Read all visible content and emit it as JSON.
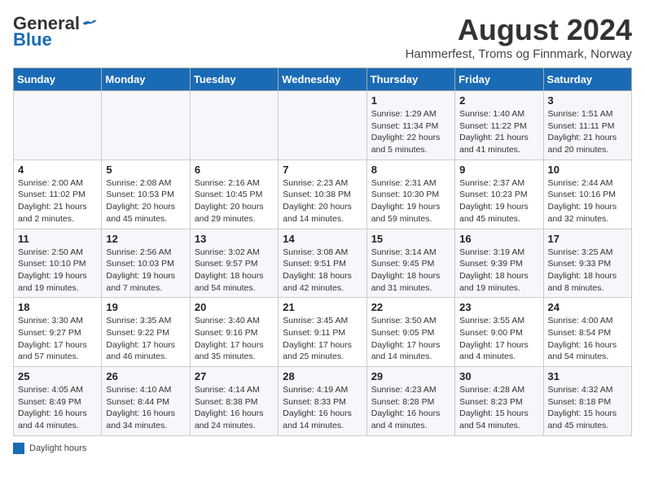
{
  "logo": {
    "general": "General",
    "blue": "Blue"
  },
  "title": "August 2024",
  "subtitle": "Hammerfest, Troms og Finnmark, Norway",
  "days_of_week": [
    "Sunday",
    "Monday",
    "Tuesday",
    "Wednesday",
    "Thursday",
    "Friday",
    "Saturday"
  ],
  "footer_label": "Daylight hours",
  "weeks": [
    [
      {
        "day": "",
        "info": ""
      },
      {
        "day": "",
        "info": ""
      },
      {
        "day": "",
        "info": ""
      },
      {
        "day": "",
        "info": ""
      },
      {
        "day": "1",
        "info": "Sunrise: 1:29 AM\nSunset: 11:34 PM\nDaylight: 22 hours and 5 minutes."
      },
      {
        "day": "2",
        "info": "Sunrise: 1:40 AM\nSunset: 11:22 PM\nDaylight: 21 hours and 41 minutes."
      },
      {
        "day": "3",
        "info": "Sunrise: 1:51 AM\nSunset: 11:11 PM\nDaylight: 21 hours and 20 minutes."
      }
    ],
    [
      {
        "day": "4",
        "info": "Sunrise: 2:00 AM\nSunset: 11:02 PM\nDaylight: 21 hours and 2 minutes."
      },
      {
        "day": "5",
        "info": "Sunrise: 2:08 AM\nSunset: 10:53 PM\nDaylight: 20 hours and 45 minutes."
      },
      {
        "day": "6",
        "info": "Sunrise: 2:16 AM\nSunset: 10:45 PM\nDaylight: 20 hours and 29 minutes."
      },
      {
        "day": "7",
        "info": "Sunrise: 2:23 AM\nSunset: 10:38 PM\nDaylight: 20 hours and 14 minutes."
      },
      {
        "day": "8",
        "info": "Sunrise: 2:31 AM\nSunset: 10:30 PM\nDaylight: 19 hours and 59 minutes."
      },
      {
        "day": "9",
        "info": "Sunrise: 2:37 AM\nSunset: 10:23 PM\nDaylight: 19 hours and 45 minutes."
      },
      {
        "day": "10",
        "info": "Sunrise: 2:44 AM\nSunset: 10:16 PM\nDaylight: 19 hours and 32 minutes."
      }
    ],
    [
      {
        "day": "11",
        "info": "Sunrise: 2:50 AM\nSunset: 10:10 PM\nDaylight: 19 hours and 19 minutes."
      },
      {
        "day": "12",
        "info": "Sunrise: 2:56 AM\nSunset: 10:03 PM\nDaylight: 19 hours and 7 minutes."
      },
      {
        "day": "13",
        "info": "Sunrise: 3:02 AM\nSunset: 9:57 PM\nDaylight: 18 hours and 54 minutes."
      },
      {
        "day": "14",
        "info": "Sunrise: 3:08 AM\nSunset: 9:51 PM\nDaylight: 18 hours and 42 minutes."
      },
      {
        "day": "15",
        "info": "Sunrise: 3:14 AM\nSunset: 9:45 PM\nDaylight: 18 hours and 31 minutes."
      },
      {
        "day": "16",
        "info": "Sunrise: 3:19 AM\nSunset: 9:39 PM\nDaylight: 18 hours and 19 minutes."
      },
      {
        "day": "17",
        "info": "Sunrise: 3:25 AM\nSunset: 9:33 PM\nDaylight: 18 hours and 8 minutes."
      }
    ],
    [
      {
        "day": "18",
        "info": "Sunrise: 3:30 AM\nSunset: 9:27 PM\nDaylight: 17 hours and 57 minutes."
      },
      {
        "day": "19",
        "info": "Sunrise: 3:35 AM\nSunset: 9:22 PM\nDaylight: 17 hours and 46 minutes."
      },
      {
        "day": "20",
        "info": "Sunrise: 3:40 AM\nSunset: 9:16 PM\nDaylight: 17 hours and 35 minutes."
      },
      {
        "day": "21",
        "info": "Sunrise: 3:45 AM\nSunset: 9:11 PM\nDaylight: 17 hours and 25 minutes."
      },
      {
        "day": "22",
        "info": "Sunrise: 3:50 AM\nSunset: 9:05 PM\nDaylight: 17 hours and 14 minutes."
      },
      {
        "day": "23",
        "info": "Sunrise: 3:55 AM\nSunset: 9:00 PM\nDaylight: 17 hours and 4 minutes."
      },
      {
        "day": "24",
        "info": "Sunrise: 4:00 AM\nSunset: 8:54 PM\nDaylight: 16 hours and 54 minutes."
      }
    ],
    [
      {
        "day": "25",
        "info": "Sunrise: 4:05 AM\nSunset: 8:49 PM\nDaylight: 16 hours and 44 minutes."
      },
      {
        "day": "26",
        "info": "Sunrise: 4:10 AM\nSunset: 8:44 PM\nDaylight: 16 hours and 34 minutes."
      },
      {
        "day": "27",
        "info": "Sunrise: 4:14 AM\nSunset: 8:38 PM\nDaylight: 16 hours and 24 minutes."
      },
      {
        "day": "28",
        "info": "Sunrise: 4:19 AM\nSunset: 8:33 PM\nDaylight: 16 hours and 14 minutes."
      },
      {
        "day": "29",
        "info": "Sunrise: 4:23 AM\nSunset: 8:28 PM\nDaylight: 16 hours and 4 minutes."
      },
      {
        "day": "30",
        "info": "Sunrise: 4:28 AM\nSunset: 8:23 PM\nDaylight: 15 hours and 54 minutes."
      },
      {
        "day": "31",
        "info": "Sunrise: 4:32 AM\nSunset: 8:18 PM\nDaylight: 15 hours and 45 minutes."
      }
    ]
  ]
}
